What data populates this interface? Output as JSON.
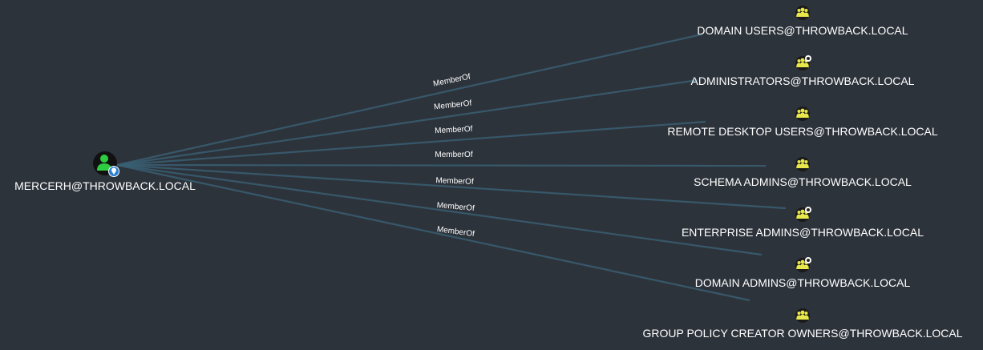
{
  "source_node": {
    "label": "MERCERH@THROWBACK.LOCAL",
    "icon": "user-icon",
    "badge_icon": "map-pin-icon",
    "icon_color": "#2ecc40"
  },
  "edge_label": "MemberOf",
  "colors": {
    "background": "#2d333b",
    "edge": "#3a5f73",
    "group_icon": "#e8e84a",
    "text": "#ffffff"
  },
  "groups": [
    {
      "label": "DOMAIN USERS@THROWBACK.LOCAL",
      "icon": "group-icon",
      "highvalue": false
    },
    {
      "label": "ADMINISTRATORS@THROWBACK.LOCAL",
      "icon": "group-icon",
      "highvalue": true
    },
    {
      "label": "REMOTE DESKTOP USERS@THROWBACK.LOCAL",
      "icon": "group-icon",
      "highvalue": false
    },
    {
      "label": "SCHEMA ADMINS@THROWBACK.LOCAL",
      "icon": "group-icon",
      "highvalue": false
    },
    {
      "label": "ENTERPRISE ADMINS@THROWBACK.LOCAL",
      "icon": "group-icon",
      "highvalue": true
    },
    {
      "label": "DOMAIN ADMINS@THROWBACK.LOCAL",
      "icon": "group-icon",
      "highvalue": true
    },
    {
      "label": "GROUP POLICY CREATOR OWNERS@THROWBACK.LOCAL",
      "icon": "group-icon",
      "highvalue": false
    }
  ]
}
